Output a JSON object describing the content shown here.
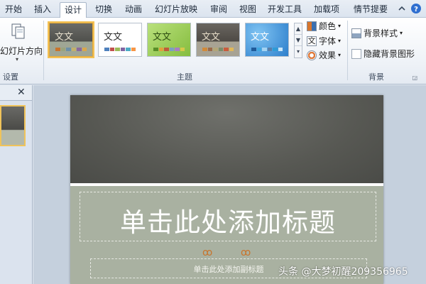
{
  "tabs": [
    "开始",
    "插入",
    "设计",
    "切换",
    "动画",
    "幻灯片放映",
    "审阅",
    "视图",
    "开发工具",
    "加载项",
    "情节提要"
  ],
  "active_tab": "设计",
  "page_setup": {
    "orientation_label": "幻灯片方向",
    "group_label": "设置"
  },
  "themes": {
    "group_label": "主题",
    "items": [
      {
        "label": "文文",
        "bg": "#5e5e5a",
        "text_color": "#e8e1cf",
        "selected": true
      },
      {
        "label": "文文",
        "bg": "#ffffff",
        "text_color": "#2a2a2a",
        "selected": false
      },
      {
        "label": "文文",
        "bg": "#9ccd5c",
        "text_color": "#2e4e12",
        "selected": false
      },
      {
        "label": "文文",
        "bg": "#5f5b55",
        "text_color": "#e6dcc8",
        "selected": false
      },
      {
        "label": "文文",
        "bg": "#3f8fd4",
        "text_color": "#ffffff",
        "selected": false
      }
    ],
    "colors_label": "颜色",
    "fonts_label": "字体",
    "effects_label": "效果"
  },
  "background": {
    "group_label": "背景",
    "styles_label": "背景样式",
    "hide_graphics_label": "隐藏背景图形"
  },
  "slide": {
    "title_placeholder": "单击此处添加标题",
    "subtitle_placeholder": "单击此处添加副标题"
  },
  "watermark": "头条 @大梦初醒209356965",
  "accent": "#f3c154"
}
